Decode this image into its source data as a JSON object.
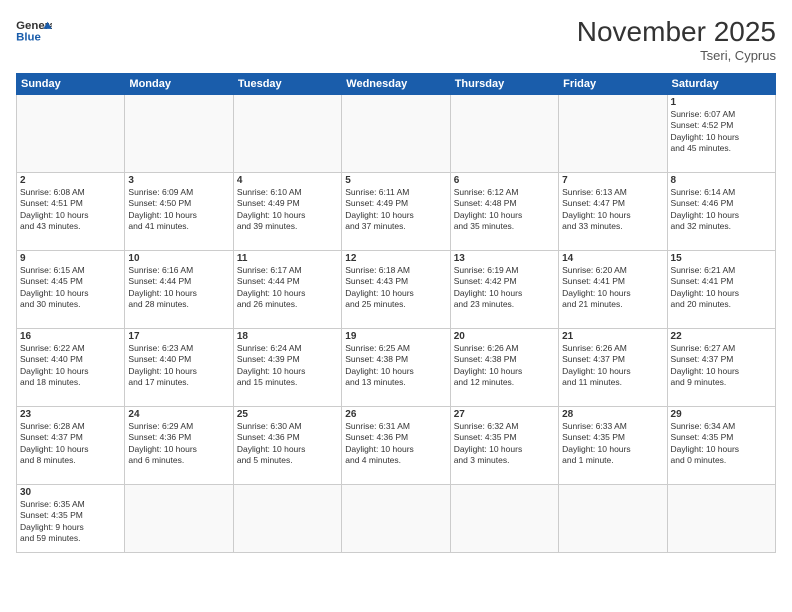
{
  "header": {
    "logo_general": "General",
    "logo_blue": "Blue",
    "month_year": "November 2025",
    "location": "Tseri, Cyprus"
  },
  "weekdays": [
    "Sunday",
    "Monday",
    "Tuesday",
    "Wednesday",
    "Thursday",
    "Friday",
    "Saturday"
  ],
  "weeks": [
    [
      {
        "day": "",
        "info": ""
      },
      {
        "day": "",
        "info": ""
      },
      {
        "day": "",
        "info": ""
      },
      {
        "day": "",
        "info": ""
      },
      {
        "day": "",
        "info": ""
      },
      {
        "day": "",
        "info": ""
      },
      {
        "day": "1",
        "info": "Sunrise: 6:07 AM\nSunset: 4:52 PM\nDaylight: 10 hours\nand 45 minutes."
      }
    ],
    [
      {
        "day": "2",
        "info": "Sunrise: 6:08 AM\nSunset: 4:51 PM\nDaylight: 10 hours\nand 43 minutes."
      },
      {
        "day": "3",
        "info": "Sunrise: 6:09 AM\nSunset: 4:50 PM\nDaylight: 10 hours\nand 41 minutes."
      },
      {
        "day": "4",
        "info": "Sunrise: 6:10 AM\nSunset: 4:49 PM\nDaylight: 10 hours\nand 39 minutes."
      },
      {
        "day": "5",
        "info": "Sunrise: 6:11 AM\nSunset: 4:49 PM\nDaylight: 10 hours\nand 37 minutes."
      },
      {
        "day": "6",
        "info": "Sunrise: 6:12 AM\nSunset: 4:48 PM\nDaylight: 10 hours\nand 35 minutes."
      },
      {
        "day": "7",
        "info": "Sunrise: 6:13 AM\nSunset: 4:47 PM\nDaylight: 10 hours\nand 33 minutes."
      },
      {
        "day": "8",
        "info": "Sunrise: 6:14 AM\nSunset: 4:46 PM\nDaylight: 10 hours\nand 32 minutes."
      }
    ],
    [
      {
        "day": "9",
        "info": "Sunrise: 6:15 AM\nSunset: 4:45 PM\nDaylight: 10 hours\nand 30 minutes."
      },
      {
        "day": "10",
        "info": "Sunrise: 6:16 AM\nSunset: 4:44 PM\nDaylight: 10 hours\nand 28 minutes."
      },
      {
        "day": "11",
        "info": "Sunrise: 6:17 AM\nSunset: 4:44 PM\nDaylight: 10 hours\nand 26 minutes."
      },
      {
        "day": "12",
        "info": "Sunrise: 6:18 AM\nSunset: 4:43 PM\nDaylight: 10 hours\nand 25 minutes."
      },
      {
        "day": "13",
        "info": "Sunrise: 6:19 AM\nSunset: 4:42 PM\nDaylight: 10 hours\nand 23 minutes."
      },
      {
        "day": "14",
        "info": "Sunrise: 6:20 AM\nSunset: 4:41 PM\nDaylight: 10 hours\nand 21 minutes."
      },
      {
        "day": "15",
        "info": "Sunrise: 6:21 AM\nSunset: 4:41 PM\nDaylight: 10 hours\nand 20 minutes."
      }
    ],
    [
      {
        "day": "16",
        "info": "Sunrise: 6:22 AM\nSunset: 4:40 PM\nDaylight: 10 hours\nand 18 minutes."
      },
      {
        "day": "17",
        "info": "Sunrise: 6:23 AM\nSunset: 4:40 PM\nDaylight: 10 hours\nand 17 minutes."
      },
      {
        "day": "18",
        "info": "Sunrise: 6:24 AM\nSunset: 4:39 PM\nDaylight: 10 hours\nand 15 minutes."
      },
      {
        "day": "19",
        "info": "Sunrise: 6:25 AM\nSunset: 4:38 PM\nDaylight: 10 hours\nand 13 minutes."
      },
      {
        "day": "20",
        "info": "Sunrise: 6:26 AM\nSunset: 4:38 PM\nDaylight: 10 hours\nand 12 minutes."
      },
      {
        "day": "21",
        "info": "Sunrise: 6:26 AM\nSunset: 4:37 PM\nDaylight: 10 hours\nand 11 minutes."
      },
      {
        "day": "22",
        "info": "Sunrise: 6:27 AM\nSunset: 4:37 PM\nDaylight: 10 hours\nand 9 minutes."
      }
    ],
    [
      {
        "day": "23",
        "info": "Sunrise: 6:28 AM\nSunset: 4:37 PM\nDaylight: 10 hours\nand 8 minutes."
      },
      {
        "day": "24",
        "info": "Sunrise: 6:29 AM\nSunset: 4:36 PM\nDaylight: 10 hours\nand 6 minutes."
      },
      {
        "day": "25",
        "info": "Sunrise: 6:30 AM\nSunset: 4:36 PM\nDaylight: 10 hours\nand 5 minutes."
      },
      {
        "day": "26",
        "info": "Sunrise: 6:31 AM\nSunset: 4:36 PM\nDaylight: 10 hours\nand 4 minutes."
      },
      {
        "day": "27",
        "info": "Sunrise: 6:32 AM\nSunset: 4:35 PM\nDaylight: 10 hours\nand 3 minutes."
      },
      {
        "day": "28",
        "info": "Sunrise: 6:33 AM\nSunset: 4:35 PM\nDaylight: 10 hours\nand 1 minute."
      },
      {
        "day": "29",
        "info": "Sunrise: 6:34 AM\nSunset: 4:35 PM\nDaylight: 10 hours\nand 0 minutes."
      }
    ],
    [
      {
        "day": "30",
        "info": "Sunrise: 6:35 AM\nSunset: 4:35 PM\nDaylight: 9 hours\nand 59 minutes."
      },
      {
        "day": "",
        "info": ""
      },
      {
        "day": "",
        "info": ""
      },
      {
        "day": "",
        "info": ""
      },
      {
        "day": "",
        "info": ""
      },
      {
        "day": "",
        "info": ""
      },
      {
        "day": "",
        "info": ""
      }
    ]
  ]
}
